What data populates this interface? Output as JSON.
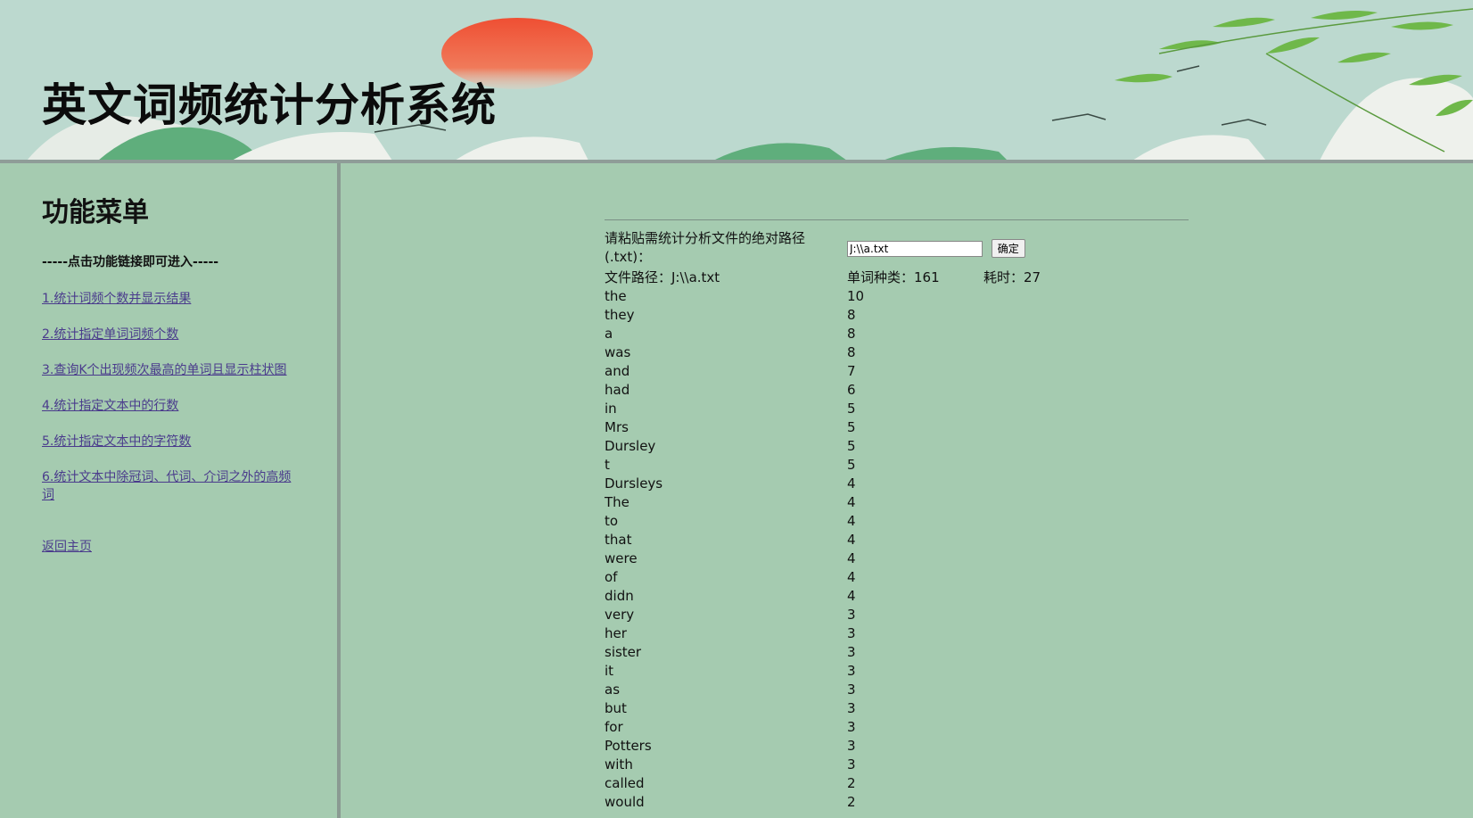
{
  "header": {
    "title": "英文词频统计分析系统"
  },
  "sidebar": {
    "title": "功能菜单",
    "hint": "-----点击功能链接即可进入-----",
    "items": [
      {
        "label": "1.统计词频个数并显示结果"
      },
      {
        "label": "2.统计指定单词词频个数"
      },
      {
        "label": "3.查询K个出现频次最高的单词且显示柱状图"
      },
      {
        "label": "4.统计指定文本中的行数"
      },
      {
        "label": "5.统计指定文本中的字符数"
      },
      {
        "label": "6.统计文本中除冠词、代词、介词之外的高频词"
      }
    ],
    "back_label": "返回主页"
  },
  "main": {
    "prompt": "请粘贴需统计分析文件的绝对路径(.txt)：",
    "input_value": "J:\\\\a.txt",
    "confirm_label": "确定",
    "file_path_label": "文件路径：J:\\\\a.txt",
    "word_types_label": "单词种类：161",
    "time_label": "耗时：27",
    "words": [
      {
        "word": "the",
        "count": "10"
      },
      {
        "word": "they",
        "count": "8"
      },
      {
        "word": "a",
        "count": "8"
      },
      {
        "word": "was",
        "count": "8"
      },
      {
        "word": "and",
        "count": "7"
      },
      {
        "word": "had",
        "count": "6"
      },
      {
        "word": "in",
        "count": "5"
      },
      {
        "word": "Mrs",
        "count": "5"
      },
      {
        "word": "Dursley",
        "count": "5"
      },
      {
        "word": "t",
        "count": "5"
      },
      {
        "word": "Dursleys",
        "count": "4"
      },
      {
        "word": "The",
        "count": "4"
      },
      {
        "word": "to",
        "count": "4"
      },
      {
        "word": "that",
        "count": "4"
      },
      {
        "word": "were",
        "count": "4"
      },
      {
        "word": "of",
        "count": "4"
      },
      {
        "word": "didn",
        "count": "4"
      },
      {
        "word": "very",
        "count": "3"
      },
      {
        "word": "her",
        "count": "3"
      },
      {
        "word": "sister",
        "count": "3"
      },
      {
        "word": "it",
        "count": "3"
      },
      {
        "word": "as",
        "count": "3"
      },
      {
        "word": "but",
        "count": "3"
      },
      {
        "word": "for",
        "count": "3"
      },
      {
        "word": "Potters",
        "count": "3"
      },
      {
        "word": "with",
        "count": "3"
      },
      {
        "word": "called",
        "count": "2"
      },
      {
        "word": "would",
        "count": "2"
      }
    ]
  },
  "colors": {
    "page_bg": "#a5cbb0",
    "header_bg": "#bcd9cf",
    "sun": "#ef5a3a",
    "link": "#4a3b8c"
  }
}
